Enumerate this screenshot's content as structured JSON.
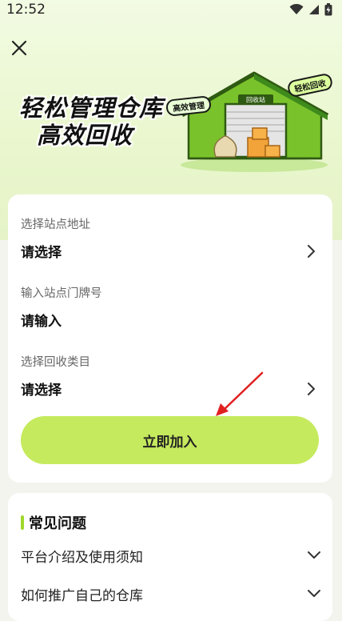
{
  "status": {
    "time": "12:52"
  },
  "hero": {
    "title_line1": "轻松管理仓库",
    "title_line2": "高效回收",
    "tag_left": "高效管理",
    "tag_right": "轻松回收",
    "sign": "回收站"
  },
  "form": {
    "fields": [
      {
        "label": "选择站点地址",
        "value": "请选择"
      },
      {
        "label": "输入站点门牌号",
        "value": "请输入"
      },
      {
        "label": "选择回收类目",
        "value": "请选择"
      }
    ],
    "submit_label": "立即加入"
  },
  "faq": {
    "title": "常见问题",
    "items": [
      {
        "q": "平台介绍及使用须知"
      },
      {
        "q": "如何推广自己的仓库"
      }
    ]
  },
  "colors": {
    "accent": "#c5ea5d",
    "warehouse_green": "#7ac22b",
    "arrow": "#e02020"
  }
}
